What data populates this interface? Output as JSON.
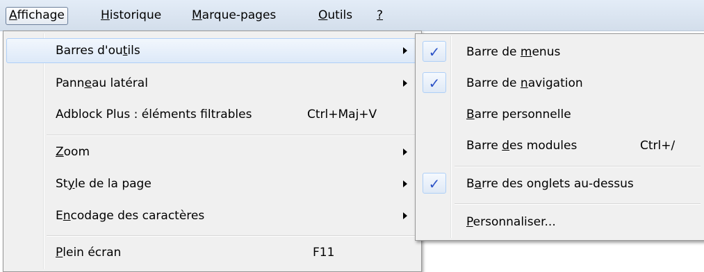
{
  "menubar": {
    "items": [
      {
        "pre": "",
        "ul": "A",
        "post": "ffichage"
      },
      {
        "pre": "",
        "ul": "H",
        "post": "istorique"
      },
      {
        "pre": "",
        "ul": "M",
        "post": "arque-pages"
      },
      {
        "pre": "",
        "ul": "O",
        "post": "utils"
      },
      {
        "pre": "",
        "ul": "?",
        "post": ""
      }
    ]
  },
  "view_menu": {
    "items": [
      {
        "pre": "Barres d'ou",
        "ul": "t",
        "post": "ils",
        "shortcut": "",
        "submenu": true
      },
      {
        "pre": "Pann",
        "ul": "e",
        "post": "au latéral",
        "shortcut": "",
        "submenu": true
      },
      {
        "pre": "Adblock Plus : éléments filtrables",
        "ul": "",
        "post": "",
        "shortcut": "Ctrl+Maj+V",
        "submenu": false
      },
      {
        "pre": "",
        "ul": "Z",
        "post": "oom",
        "shortcut": "",
        "submenu": true
      },
      {
        "pre": "St",
        "ul": "y",
        "post": "le de la page",
        "shortcut": "",
        "submenu": true
      },
      {
        "pre": "E",
        "ul": "n",
        "post": "codage des caractères",
        "shortcut": "",
        "submenu": true
      },
      {
        "pre": "",
        "ul": "P",
        "post": "lein écran",
        "shortcut": "F11",
        "submenu": false
      }
    ]
  },
  "toolbars_submenu": {
    "items": [
      {
        "pre": "Barre de ",
        "ul": "m",
        "post": "enus",
        "shortcut": "",
        "checked": true
      },
      {
        "pre": "Barre de ",
        "ul": "n",
        "post": "avigation",
        "shortcut": "",
        "checked": true
      },
      {
        "pre": "",
        "ul": "B",
        "post": "arre personnelle",
        "shortcut": "",
        "checked": false
      },
      {
        "pre": "Barre ",
        "ul": "d",
        "post": "es modules",
        "shortcut": "Ctrl+/",
        "checked": false
      },
      {
        "pre": "B",
        "ul": "a",
        "post": "rre des onglets au-dessus",
        "shortcut": "",
        "checked": true
      },
      {
        "pre": "",
        "ul": "P",
        "post": "ersonnaliser...",
        "shortcut": "",
        "checked": false
      }
    ],
    "check_glyph": "✓"
  }
}
